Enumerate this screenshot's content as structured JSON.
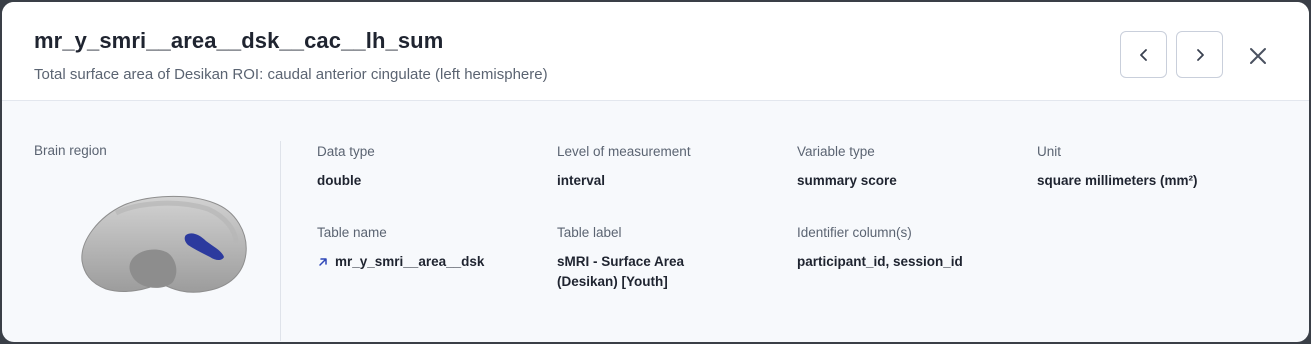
{
  "header": {
    "title": "mr_y_smri__area__dsk__cac__lh_sum",
    "subtitle": "Total surface area of Desikan ROI: caudal anterior cingulate (left hemisphere)",
    "prev_icon": "chevron-left-icon",
    "next_icon": "chevron-right-icon",
    "close_icon": "close-icon"
  },
  "brain": {
    "label": "Brain region",
    "highlight_color": "#2c3a9e"
  },
  "fields": {
    "data_type": {
      "label": "Data type",
      "value": "double"
    },
    "level": {
      "label": "Level of measurement",
      "value": "interval"
    },
    "variable_type": {
      "label": "Variable type",
      "value": "summary score"
    },
    "unit": {
      "label": "Unit",
      "value": "square millimeters (mm²)"
    },
    "table_name": {
      "label": "Table name",
      "value": "mr_y_smri__area__dsk"
    },
    "table_label": {
      "label": "Table label",
      "value": "sMRI - Surface Area (Desikan) [Youth]"
    },
    "identifier": {
      "label": "Identifier column(s)",
      "value": "participant_id, session_id"
    }
  },
  "colors": {
    "link": "#2f47b8",
    "text": "#1f2430",
    "muted": "#5b6472"
  }
}
